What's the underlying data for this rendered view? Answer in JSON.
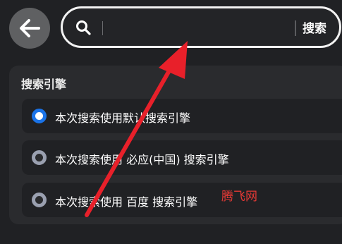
{
  "header": {
    "back_icon": "arrow-left-icon",
    "search": {
      "icon": "search-icon",
      "value": "",
      "placeholder": "",
      "submit_label": "搜索"
    }
  },
  "engine_panel": {
    "title": "搜索引擎",
    "options": [
      {
        "label": "本次搜索使用默认搜索引擎",
        "selected": true
      },
      {
        "label": "本次搜索使用 必应(中国) 搜索引擎",
        "selected": false
      },
      {
        "label": "本次搜索使用 百度 搜索引擎",
        "selected": false
      }
    ]
  },
  "watermark": "腾飞网",
  "colors": {
    "background": "#202124",
    "panel": "#2a2b2e",
    "radio_selected": "#1a73e8",
    "radio_unselected": "#9aa0b0",
    "annotation_arrow": "#e8202a",
    "watermark": "#e53935"
  }
}
